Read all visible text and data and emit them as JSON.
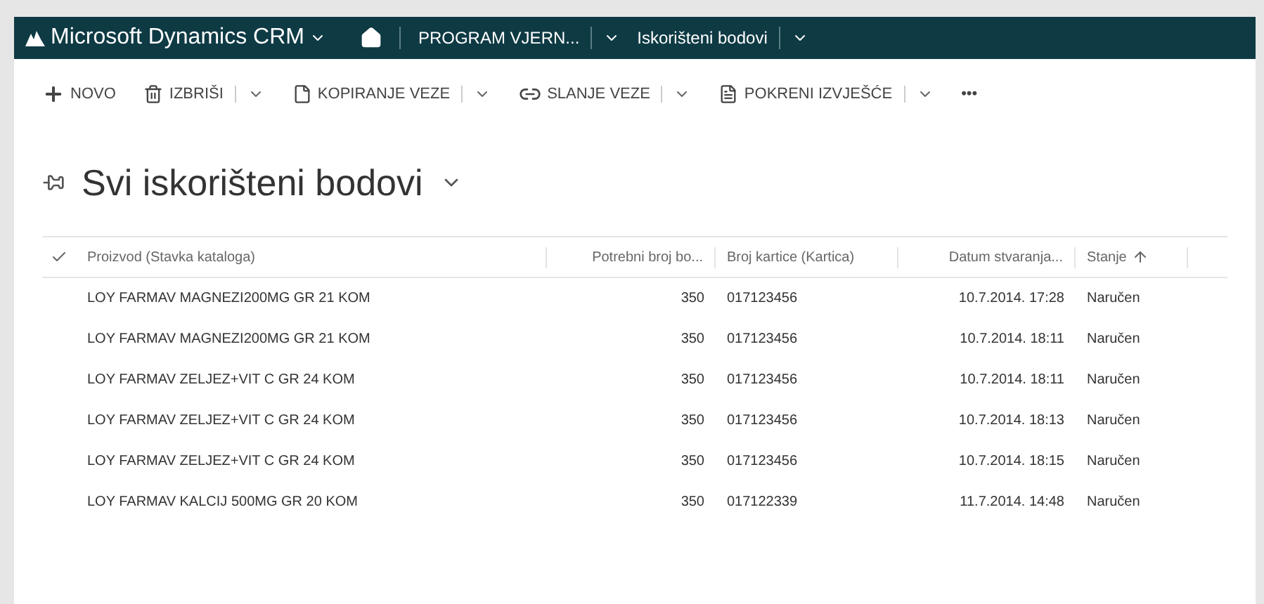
{
  "nav": {
    "app_title": "Microsoft Dynamics CRM",
    "breadcrumbs": [
      {
        "label": "PROGRAM VJERN..."
      },
      {
        "label": "Iskorišteni bodovi"
      }
    ]
  },
  "toolbar": [
    {
      "kind": "plus",
      "label": "NOVO",
      "dropdown": false
    },
    {
      "kind": "trash",
      "label": "IZBRIŠI",
      "dropdown": true
    },
    {
      "kind": "page",
      "label": "KOPIRANJE VEZE",
      "dropdown": true
    },
    {
      "kind": "link",
      "label": "SLANJE VEZE",
      "dropdown": true
    },
    {
      "kind": "report",
      "label": "POKRENI IZVJEŠĆE",
      "dropdown": true
    },
    {
      "kind": "more",
      "label": "•••",
      "dropdown": false
    }
  ],
  "view_title": "Svi iskorišteni bodovi",
  "table": {
    "columns": [
      {
        "label": "Proizvod (Stavka kataloga)",
        "sorted": false
      },
      {
        "label": "Potrebni broj bo...",
        "sorted": false
      },
      {
        "label": "Broj kartice (Kartica)",
        "sorted": false
      },
      {
        "label": "Datum stvaranja...",
        "sorted": false
      },
      {
        "label": "Stanje",
        "sorted": true
      }
    ],
    "rows": [
      [
        "LOY FARMAV MAGNEZI200MG GR 21 KOM",
        "350",
        "017123456",
        "10.7.2014. 17:28",
        "Naručen"
      ],
      [
        "LOY FARMAV MAGNEZI200MG GR 21 KOM",
        "350",
        "017123456",
        "10.7.2014. 18:11",
        "Naručen"
      ],
      [
        "LOY FARMAV ZELJEZ+VIT C GR 24 KOM",
        "350",
        "017123456",
        "10.7.2014. 18:11",
        "Naručen"
      ],
      [
        "LOY FARMAV ZELJEZ+VIT C GR 24 KOM",
        "350",
        "017123456",
        "10.7.2014. 18:13",
        "Naručen"
      ],
      [
        "LOY FARMAV ZELJEZ+VIT C GR 24 KOM",
        "350",
        "017123456",
        "10.7.2014. 18:15",
        "Naručen"
      ],
      [
        "LOY FARMAV KALCIJ 500MG GR 20 KOM",
        "350",
        "017122339",
        "11.7.2014. 14:48",
        "Naručen"
      ]
    ]
  }
}
